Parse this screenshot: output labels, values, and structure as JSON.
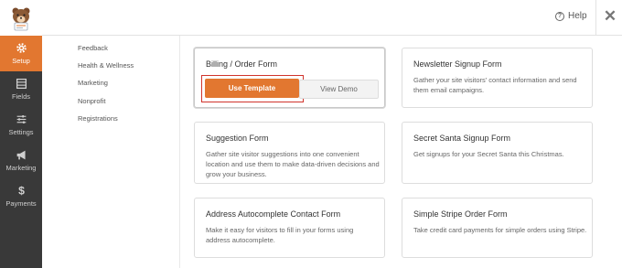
{
  "header": {
    "help_label": "Help",
    "close_glyph": "✕"
  },
  "sidebar": {
    "items": [
      {
        "label": "Setup",
        "icon": "gear-icon",
        "active": true
      },
      {
        "label": "Fields",
        "icon": "fields-icon",
        "active": false
      },
      {
        "label": "Settings",
        "icon": "sliders-icon",
        "active": false
      },
      {
        "label": "Marketing",
        "icon": "megaphone-icon",
        "active": false
      },
      {
        "label": "Payments",
        "icon": "dollar-icon",
        "active": false
      }
    ]
  },
  "categories": [
    "Feedback",
    "Health & Wellness",
    "Marketing",
    "Nonprofit",
    "Registrations"
  ],
  "templates": [
    {
      "title": "Billing / Order Form",
      "selected": true,
      "use_label": "Use Template",
      "demo_label": "View Demo"
    },
    {
      "title": "Newsletter Signup Form",
      "description": "Gather your site visitors' contact information and send them email campaigns."
    },
    {
      "title": "Suggestion Form",
      "description": "Gather site visitor suggestions into one convenient location and use them to make data-driven decisions and grow your business."
    },
    {
      "title": "Secret Santa Signup Form",
      "description": "Get signups for your Secret Santa this Christmas."
    },
    {
      "title": "Address Autocomplete Contact Form",
      "description": "Make it easy for visitors to fill in your forms using address autocomplete."
    },
    {
      "title": "Simple Stripe Order Form",
      "description": "Take credit card payments for simple orders using Stripe."
    }
  ],
  "colors": {
    "accent": "#e27730",
    "sidebar": "#393939",
    "highlight": "#d0342c"
  }
}
